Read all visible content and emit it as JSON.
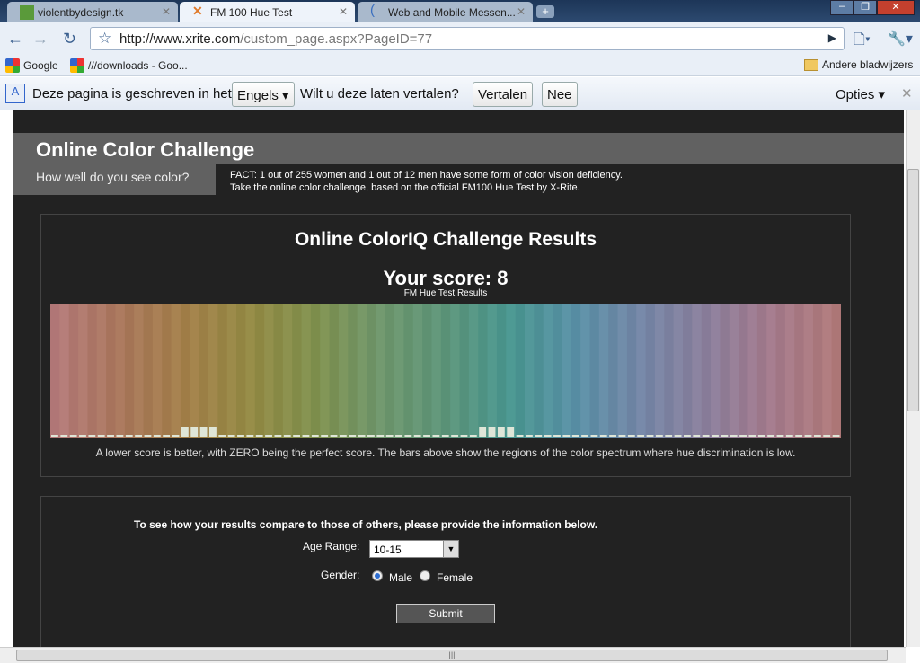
{
  "browser": {
    "tabs": [
      {
        "label": "violentbydesign.tk",
        "active": false
      },
      {
        "label": "FM 100 Hue Test",
        "active": true
      },
      {
        "label": "Web and Mobile Messen...",
        "active": false
      }
    ],
    "url_domain": "http://www.xrite.com",
    "url_path": "/custom_page.aspx?PageID=77",
    "bookmarks": [
      {
        "label": "Google"
      },
      {
        "label": "///downloads - Goo..."
      }
    ],
    "other_bookmarks": "Andere bladwijzers",
    "translate_bar": {
      "text": "Deze pagina is geschreven in het",
      "language": "Engels",
      "question": "Wilt u deze laten vertalen?",
      "translate_button": "Vertalen",
      "no_button": "Nee",
      "options": "Opties"
    }
  },
  "page": {
    "title": "Online Color Challenge",
    "subtitle": "How well do you see color?",
    "fact_line1": "FACT: 1 out of 255 women and 1 out of 12 men have some form of color vision deficiency.",
    "fact_line2": "Take the online color challenge, based on the official FM100 Hue Test by X-Rite.",
    "results": {
      "title": "Online ColorIQ Challenge Results",
      "score_label": "Your score: 8",
      "caption": "FM Hue Test Results",
      "note": "A lower score is better, with ZERO being the perfect score. The bars above show the regions of the color spectrum where hue discrimination is low."
    },
    "form": {
      "intro": "To see how your results compare to those of others, please provide the information below.",
      "age_label": "Age Range:",
      "age_value": "10-15",
      "gender_label": "Gender:",
      "gender_options": [
        "Male",
        "Female"
      ],
      "gender_selected": "Male",
      "submit": "Submit"
    }
  },
  "chart_data": {
    "type": "bar",
    "caption": "FM Hue Test Results",
    "cap_count": 85,
    "error_caps": [
      14,
      15,
      16,
      17,
      46,
      47,
      48,
      49
    ],
    "spectrum_colors": [
      "#b47a7a",
      "#a9775c",
      "#a3804a",
      "#948a45",
      "#80914f",
      "#6f966c",
      "#5d957a",
      "#4a9690",
      "#5a90a6",
      "#7486a6",
      "#8b7f9c",
      "#a37a8c",
      "#b07a7a"
    ]
  }
}
